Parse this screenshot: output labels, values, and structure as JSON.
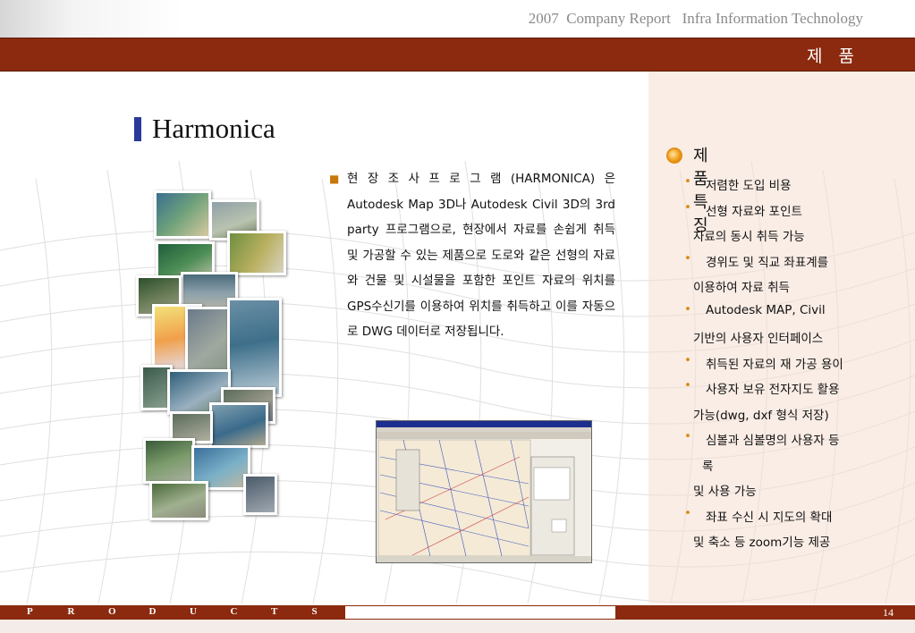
{
  "header": {
    "report": "2007  Company Report   Infra Information Technology",
    "section": "제 품"
  },
  "main": {
    "title": "Harmonica",
    "description": "현 장 조 사   프 로 그 램 (HARMONICA) 은 Autodesk Map 3D나 Autodesk Civil 3D의 3rd party 프로그램으로, 현장에서 자료를 손쉽게 취득 및 가공할 수 있는 제품으로 도로와 같은 선형의 자료와 건물 및 시설물을 포함한 포인트 자료의 위치를 GPS수신기를 이용하여 위치를 취득하고 이를 자동으로 DWG 데이터로 저장됩니다."
  },
  "features": {
    "title": "제품 특징",
    "lines": [
      {
        "text": "저렴한 도입 비용",
        "bullet": true
      },
      {
        "text": "선형 자료와 포인트",
        "bullet": true
      },
      {
        "text": "자료의 동시 취득 가능",
        "bullet": false
      },
      {
        "text": "경위도 및 직교 좌표계를",
        "bullet": true
      },
      {
        "text": "이용하여 자료 취득",
        "bullet": false
      },
      {
        "text": "Autodesk MAP, Civil",
        "bullet": true
      },
      {
        "text": "기반의 사용자 인터페이스",
        "bullet": false
      },
      {
        "text": "취득된 자료의 재 가공 용이",
        "bullet": true
      },
      {
        "text": "사용자 보유 전자지도 활용",
        "bullet": true
      },
      {
        "text": "가능(dwg, dxf 형식 저장)",
        "bullet": false
      },
      {
        "text": "심볼과 심볼명의 사용자 등",
        "bullet": true
      },
      {
        "text": "록",
        "bullet": false
      },
      {
        "text": "및 사용 가능",
        "bullet": false
      },
      {
        "text": "좌표 수신 시 지도의 확대",
        "bullet": true
      },
      {
        "text": "및 축소 등 zoom기능 제공",
        "bullet": false
      }
    ]
  },
  "footer": {
    "letters": [
      "P",
      "R",
      "O",
      "D",
      "U",
      "C",
      "T",
      "S"
    ],
    "page": "14"
  },
  "colors": {
    "bar": "#8b2a0e",
    "title_mark": "#2a3a9a",
    "bullet": "#d98a14"
  }
}
